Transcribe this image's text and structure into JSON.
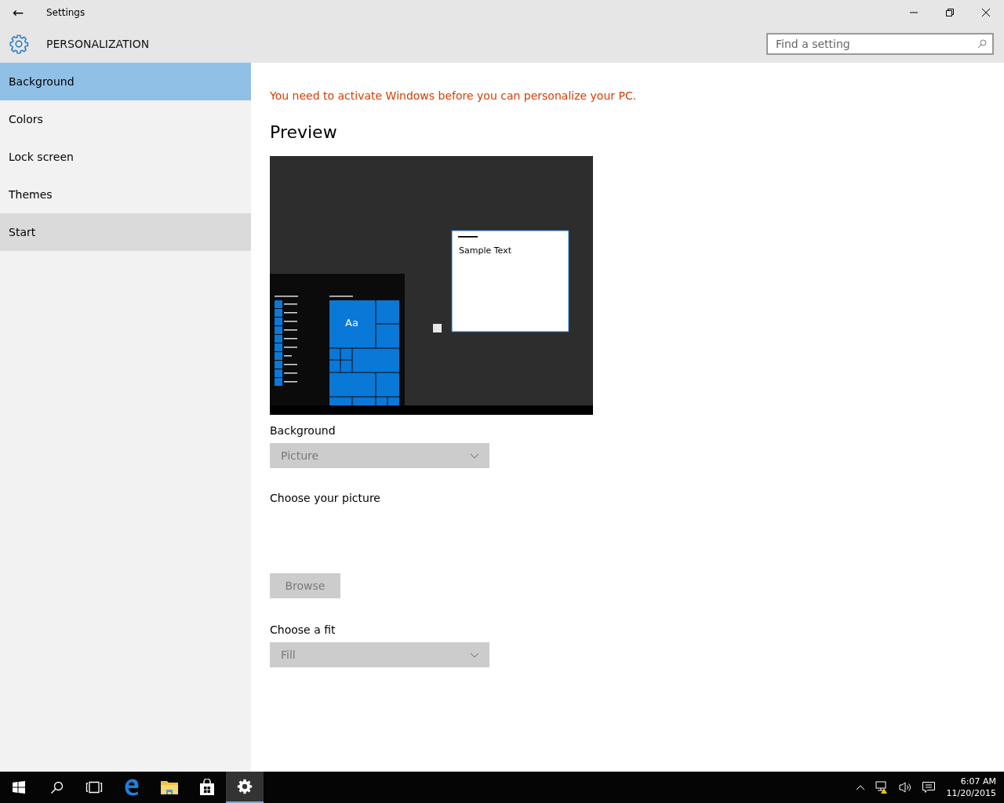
{
  "window": {
    "title": "Settings",
    "back": "←"
  },
  "header": {
    "title": "PERSONALIZATION"
  },
  "search": {
    "placeholder": "Find a setting"
  },
  "sidebar": {
    "items": [
      {
        "label": "Background",
        "selected": true,
        "hovered": false
      },
      {
        "label": "Colors",
        "selected": false,
        "hovered": false
      },
      {
        "label": "Lock screen",
        "selected": false,
        "hovered": false
      },
      {
        "label": "Themes",
        "selected": false,
        "hovered": false
      },
      {
        "label": "Start",
        "selected": false,
        "hovered": true
      }
    ]
  },
  "content": {
    "warning": "You need to activate Windows before you can personalize your PC.",
    "preview_title": "Preview",
    "preview": {
      "tile_label": "Aa",
      "sample_text": "Sample Text"
    },
    "background": {
      "label": "Background",
      "value": "Picture",
      "disabled": true
    },
    "picture": {
      "label": "Choose your picture",
      "button": "Browse",
      "disabled": true
    },
    "fit": {
      "label": "Choose a fit",
      "value": "Fill",
      "disabled": true
    }
  },
  "taskbar": {
    "apps": [
      {
        "kind": "start",
        "active": false
      },
      {
        "kind": "search",
        "active": false
      },
      {
        "kind": "taskview",
        "active": false
      },
      {
        "kind": "edge",
        "active": false
      },
      {
        "kind": "explorer",
        "active": false
      },
      {
        "kind": "store",
        "active": false
      },
      {
        "kind": "settings",
        "active": true
      }
    ],
    "time": "6:07 AM",
    "date": "11/20/2015"
  }
}
